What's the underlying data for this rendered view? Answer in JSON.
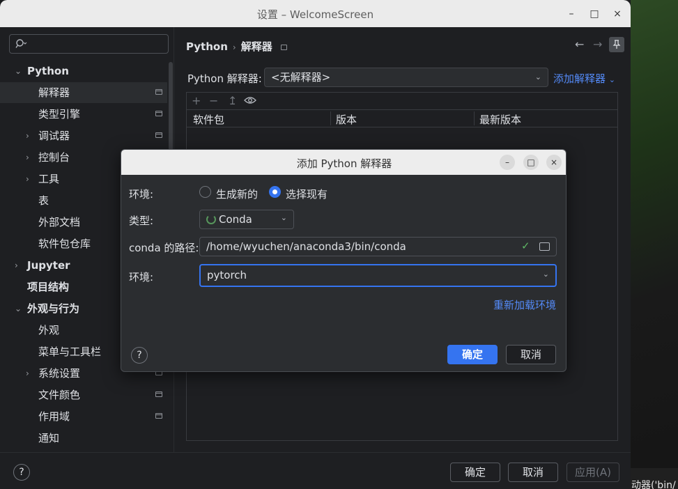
{
  "window": {
    "title": "设置 – WelcomeScreen",
    "controls": {
      "minimize": "–",
      "maximize": "□",
      "close": "×"
    }
  },
  "sidebar": {
    "search": {
      "placeholder": "",
      "value": "",
      "icon": "search-icon"
    },
    "items": [
      {
        "label": "Python",
        "bold": true,
        "expand": "expanded"
      },
      {
        "label": "解释器",
        "selected": true,
        "icon": "pin-icon"
      },
      {
        "label": "类型引擎",
        "icon": "pin-icon"
      },
      {
        "label": "调试器",
        "expand": "collapsed",
        "icon": "pin-icon"
      },
      {
        "label": "控制台",
        "expand": "collapsed"
      },
      {
        "label": "工具",
        "expand": "collapsed"
      },
      {
        "label": "表"
      },
      {
        "label": "外部文档"
      },
      {
        "label": "软件包仓库"
      },
      {
        "label": "Jupyter",
        "bold": true,
        "expand": "collapsed"
      },
      {
        "label": "项目结构",
        "bold": true
      },
      {
        "label": "外观与行为",
        "bold": true,
        "expand": "expanded"
      },
      {
        "label": "外观"
      },
      {
        "label": "菜单与工具栏"
      },
      {
        "label": "系统设置",
        "expand": "collapsed",
        "icon": "pin-icon"
      },
      {
        "label": "文件颜色",
        "icon": "pin-icon"
      },
      {
        "label": "作用域",
        "icon": "pin-icon"
      },
      {
        "label": "通知"
      }
    ]
  },
  "content": {
    "breadcrumb": {
      "root": "Python",
      "separator": "›",
      "leaf": "解释器"
    },
    "nav": {
      "back": "←",
      "forward": "→"
    },
    "interpreter": {
      "label": "Python 解释器:",
      "value": "<无解释器>",
      "add_link": "添加解释器"
    },
    "packages": {
      "toolbar": {
        "add": "+",
        "remove": "−",
        "upgrade": "↥",
        "show": "eye-icon"
      },
      "columns": [
        "软件包",
        "版本",
        "最新版本"
      ],
      "rows": []
    }
  },
  "dialog": {
    "title": "添加 Python 解释器",
    "controls": {
      "minimize": "–",
      "maximize": "□",
      "close": "×"
    },
    "env_label": "环境:",
    "radio_new": "生成新的",
    "radio_existing": "选择现有",
    "selected_radio": "选择现有",
    "type_label": "类型:",
    "type_value": "Conda",
    "path_label": "conda 的路径:",
    "path_value": "/home/wyuchen/anaconda3/bin/conda",
    "env_label2": "环境:",
    "env_value": "pytorch",
    "reload_link": "重新加载环境",
    "help": "?",
    "ok": "确定",
    "cancel": "取消"
  },
  "footer": {
    "help": "?",
    "ok": "确定",
    "cancel": "取消",
    "apply": "应用(A)"
  },
  "desktop": {
    "partial_text": "动器('bin/"
  },
  "colors": {
    "accent": "#3574f0",
    "link": "#548af7",
    "valid": "#5fb865",
    "background": "#1e1f22",
    "panel": "#2b2d30"
  }
}
